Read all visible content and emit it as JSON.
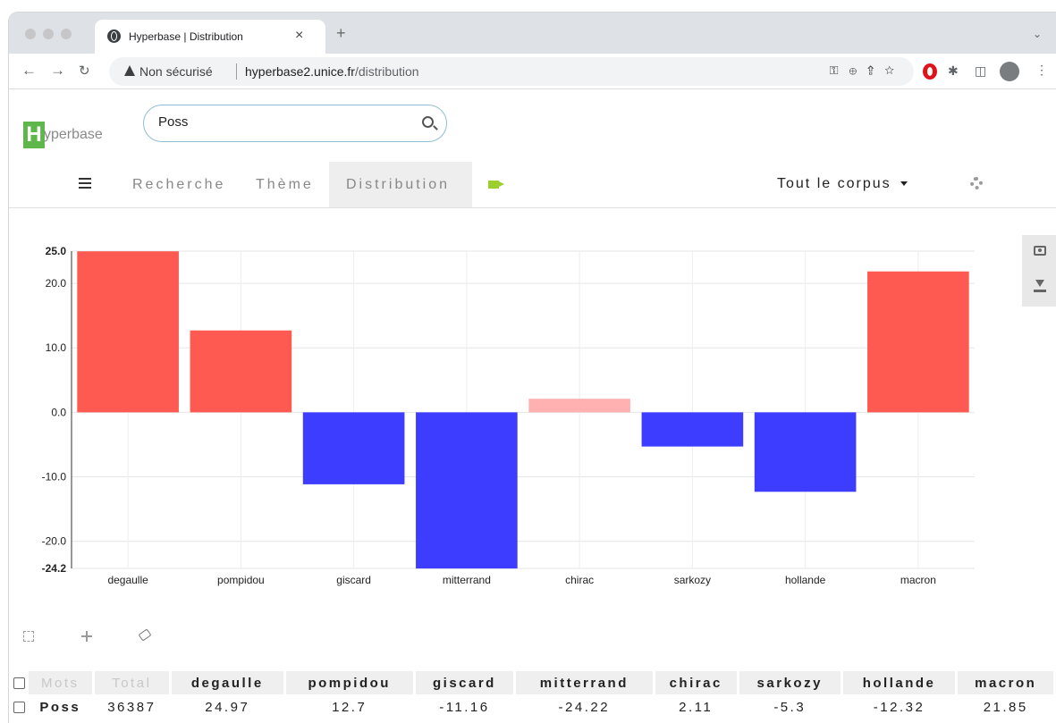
{
  "browser": {
    "tab_title": "Hyperbase | Distribution",
    "tab_close": "×",
    "new_tab": "+",
    "tab_menu": "⌄",
    "security_label": "Non sécurisé",
    "url_domain": "hyperbase2.unice.fr",
    "url_path": "/distribution",
    "omnibox_icons": [
      "key-icon",
      "zoom-icon",
      "share-icon",
      "star-icon"
    ],
    "extension_icons": [
      "opera-icon",
      "puzzle-icon",
      "sidepanel-icon"
    ]
  },
  "app": {
    "logo_letter": "H",
    "logo_rest": "yperbase",
    "search_value": "Poss",
    "menu": {
      "recherche": "Recherche",
      "theme": "Thème",
      "distribution": "Distribution"
    },
    "corpus_select": "Tout le corpus"
  },
  "colors": {
    "positive_strong": "#ff5a52",
    "positive_weak": "#ffb1b1",
    "negative": "#3d3dff",
    "logo_green": "#5fb74c",
    "video_green": "#9bcf2e"
  },
  "chart_data": {
    "type": "bar",
    "categories": [
      "degaulle",
      "pompidou",
      "giscard",
      "mitterrand",
      "chirac",
      "sarkozy",
      "hollande",
      "macron"
    ],
    "values": [
      24.97,
      12.7,
      -11.16,
      -24.22,
      2.11,
      -5.3,
      -12.32,
      21.85
    ],
    "ylim": [
      -24.2,
      25.0
    ],
    "yticks": [
      "25.0",
      "20.0",
      "10.0",
      "0.0",
      "-10.0",
      "-20.0",
      "-24.2"
    ],
    "ytick_values": [
      25.0,
      20.0,
      10.0,
      0.0,
      -10.0,
      -20.0,
      -24.2
    ],
    "grid": true,
    "title": "",
    "xlabel": "",
    "ylabel": ""
  },
  "table": {
    "headers": [
      "Mots",
      "Total",
      "degaulle",
      "pompidou",
      "giscard",
      "mitterrand",
      "chirac",
      "sarkozy",
      "hollande",
      "macron"
    ],
    "rows": [
      {
        "word": "Poss",
        "total": "36387",
        "values": [
          "24.97",
          "12.7",
          "-11.16",
          "-24.22",
          "2.11",
          "-5.3",
          "-12.32",
          "21.85"
        ]
      }
    ]
  }
}
